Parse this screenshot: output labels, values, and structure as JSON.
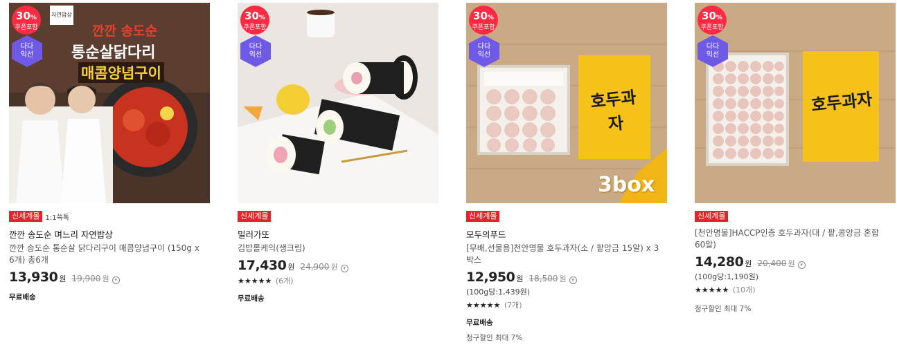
{
  "products": [
    {
      "discount_pct": "30",
      "discount_unit": "%",
      "coupon_label": "쿠폰포함",
      "dada_label_1": "다다",
      "dada_label_2": "익선",
      "image_text_1": "깐깐 송도순",
      "image_text_2": "통순살닭다리",
      "image_text_3": "매콤양념구이",
      "image_logo": "자연밥상",
      "tag": "신세계몰",
      "tag_extra": "1:1쓱톡",
      "brand": "깐깐 송도순 며느리 자연밥상",
      "name": "깐깐 송도순 통순살 닭다리구이 매콤양념구이 (150g x 6개) 총6개",
      "price": "13,930",
      "won": "원",
      "original_price": "19,900",
      "shipping": "무료배송"
    },
    {
      "discount_pct": "30",
      "discount_unit": "%",
      "coupon_label": "쿠폰포함",
      "dada_label_1": "다다",
      "dada_label_2": "익선",
      "tag": "신세계몰",
      "brand": "밀러가또",
      "name": "김밥롤케익(생크림)",
      "price": "17,430",
      "won": "원",
      "original_price": "24,900",
      "rating_stars": "★★★★★",
      "rating_count": "(6개)",
      "shipping": "무료배송"
    },
    {
      "discount_pct": "30",
      "discount_unit": "%",
      "coupon_label": "쿠폰포함",
      "dada_label_1": "다다",
      "dada_label_2": "익선",
      "image_text_1": "3box",
      "box_label": "호두과자",
      "tag": "신세계몰",
      "brand": "모두의푸드",
      "name": "[무배,선물용]천안명물 호두과자(소 / 팥앙금 15알) x 3박스",
      "price": "12,950",
      "won": "원",
      "original_price": "18,500",
      "unit_price": "(100g당:1,439원)",
      "rating_stars": "★★★★★",
      "rating_count": "(7개)",
      "shipping": "무료배송",
      "billing_discount": "청구할인 최대 7%"
    },
    {
      "discount_pct": "30",
      "discount_unit": "%",
      "coupon_label": "쿠폰포함",
      "dada_label_1": "다다",
      "dada_label_2": "익선",
      "box_label": "호두과자",
      "tag": "신세계몰",
      "name": "[천안명물]HACCP인증 호두과자(대 / 팥,콩앙금 혼합 60알)",
      "price": "14,280",
      "won": "원",
      "original_price": "20,400",
      "unit_price": "(100g당:1,190원)",
      "rating_stars": "★★★★★",
      "rating_count": "(10개)",
      "billing_discount": "청구할인 최대 7%"
    }
  ],
  "colors": {
    "tag_red": "#e8222b",
    "badge_red": "#ff2b42",
    "dada_purple": "#6f5ae8"
  },
  "icons": {
    "price_info": "info-circle-icon",
    "star": "star-icon"
  }
}
